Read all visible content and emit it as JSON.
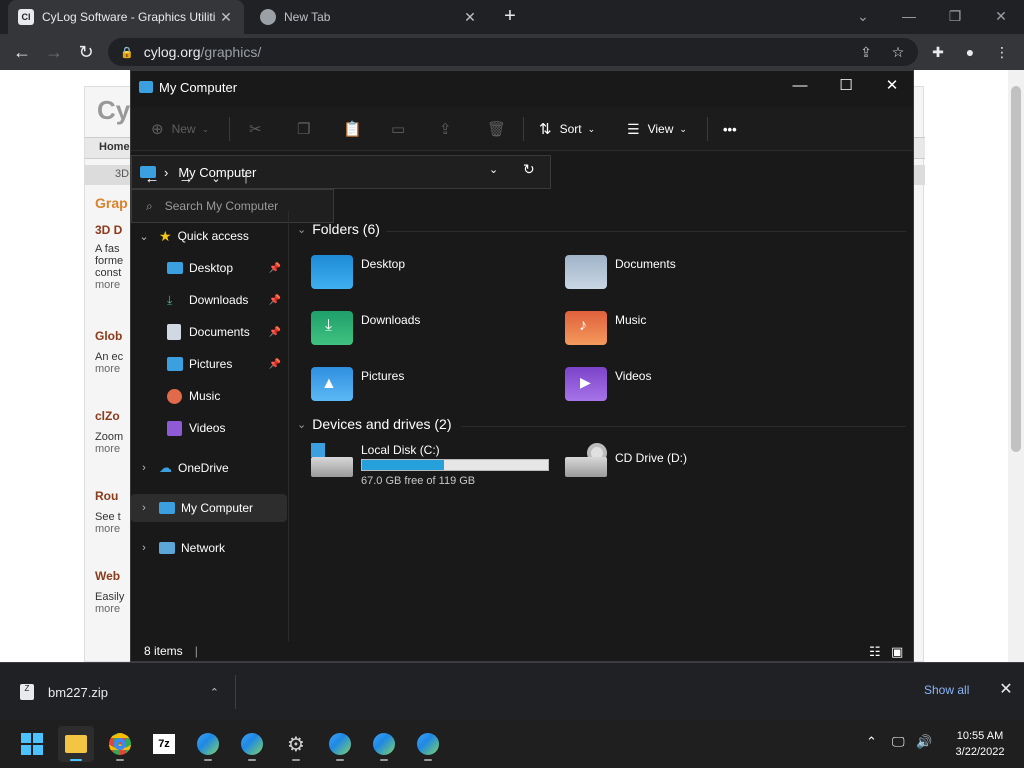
{
  "browser": {
    "tabs": [
      {
        "title": "CyLog Software - Graphics Utiliti",
        "favicon": "Cl"
      },
      {
        "title": "New Tab",
        "favicon": ""
      }
    ],
    "url_host": "cylog.org",
    "url_path": "/graphics/"
  },
  "page": {
    "logo_fragment": "Cy",
    "nav_home": "Home",
    "sub_3d": "3D",
    "section_title": "Grap",
    "entries": [
      {
        "title": "3D D",
        "lines": [
          "A fas",
          "forme",
          "const",
          "more"
        ]
      },
      {
        "title": "Glob",
        "lines": [
          "An ec",
          "more"
        ]
      },
      {
        "title": "clZo",
        "lines": [
          "Zoom",
          "more"
        ]
      },
      {
        "title": "Rou",
        "lines": [
          "See t",
          "more"
        ]
      },
      {
        "title": "Web",
        "lines": [
          "Easily",
          "more"
        ]
      }
    ]
  },
  "explorer": {
    "title": "My Computer",
    "commands": {
      "new": "New",
      "sort": "Sort",
      "view": "View",
      "more": "•••"
    },
    "address": "My Computer",
    "search_placeholder": "Search My Computer",
    "nav": {
      "quick_access": "Quick access",
      "quick_items": [
        "Desktop",
        "Downloads",
        "Documents",
        "Pictures",
        "Music",
        "Videos"
      ],
      "onedrive": "OneDrive",
      "my_computer": "My Computer",
      "network": "Network"
    },
    "folders_header": "Folders (6)",
    "folders": [
      "Desktop",
      "Documents",
      "Downloads",
      "Music",
      "Pictures",
      "Videos"
    ],
    "drives_header": "Devices and drives (2)",
    "drives": [
      {
        "name": "Local Disk (C:)",
        "free_text": "67.0 GB free of 119 GB",
        "used_fraction": 0.44
      },
      {
        "name": "CD Drive (D:)"
      }
    ],
    "status": "8 items"
  },
  "download_shelf": {
    "file": "bm227.zip",
    "show_all": "Show all"
  },
  "taskbar": {
    "time": "10:55 AM",
    "date": "3/22/2022",
    "app_7z": "7z"
  },
  "colors": {
    "accent": "#4cc2ff",
    "drive_fill": "#26a0da",
    "link": "#8ab4f8"
  }
}
